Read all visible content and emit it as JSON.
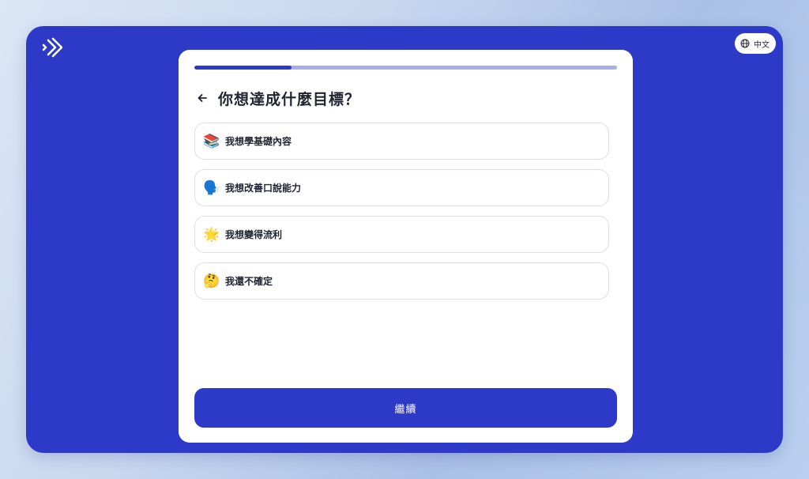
{
  "app": {
    "logo_icon": "chevrons-right-logo-icon",
    "language": {
      "label": "中文",
      "icon": "globe-icon"
    }
  },
  "progress": {
    "fraction": 0.23
  },
  "header": {
    "back_icon": "arrow-left-icon",
    "title": "你想達成什麼目標？"
  },
  "options": [
    {
      "emoji": "📚",
      "label": "我想學基礎內容"
    },
    {
      "emoji": "🗣️",
      "label": "我想改善口說能力"
    },
    {
      "emoji": "🌟",
      "label": "我想變得流利"
    },
    {
      "emoji": "🤔",
      "label": "我還不確定"
    }
  ],
  "continue_button": {
    "label": "繼續"
  },
  "colors": {
    "brand": "#2d3ac8",
    "progress_track": "#a9aee6",
    "text": "#1f2430",
    "border": "#dcdfe6"
  }
}
